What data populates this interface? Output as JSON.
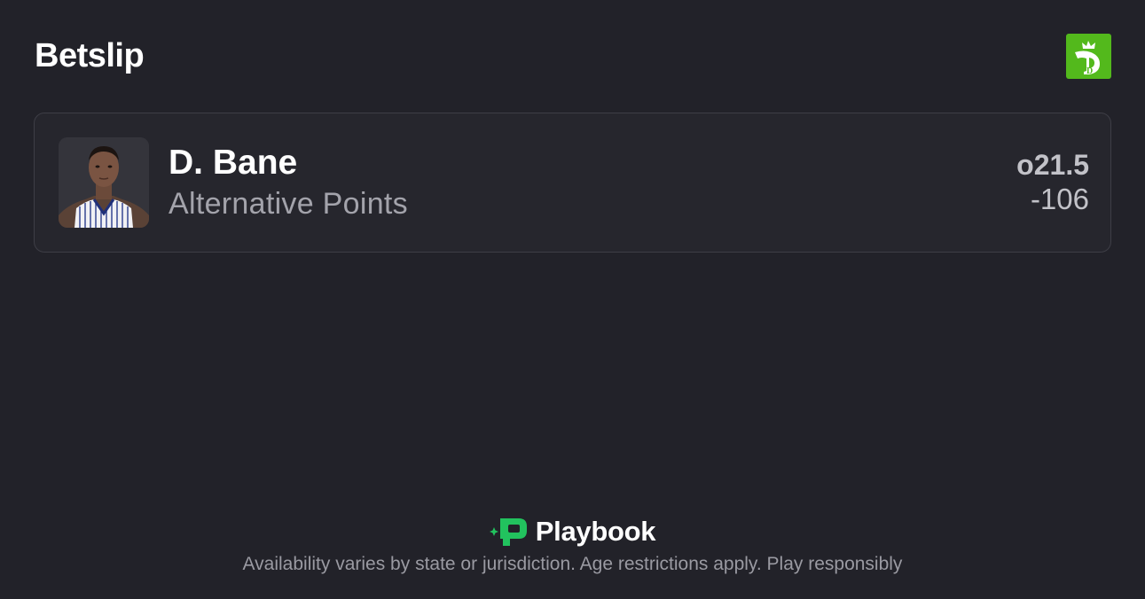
{
  "header": {
    "title": "Betslip",
    "brand_icon": "draftkings-logo",
    "brand_color": "#53B91C"
  },
  "bet": {
    "player_name": "D. Bane",
    "market": "Alternative Points",
    "line": "o21.5",
    "odds": "-106"
  },
  "footer": {
    "brand_name": "Playbook",
    "brand_icon": "playbook-logo",
    "brand_color": "#22C25E",
    "disclaimer": "Availability varies by state or jurisdiction. Age restrictions apply. Play responsibly"
  }
}
